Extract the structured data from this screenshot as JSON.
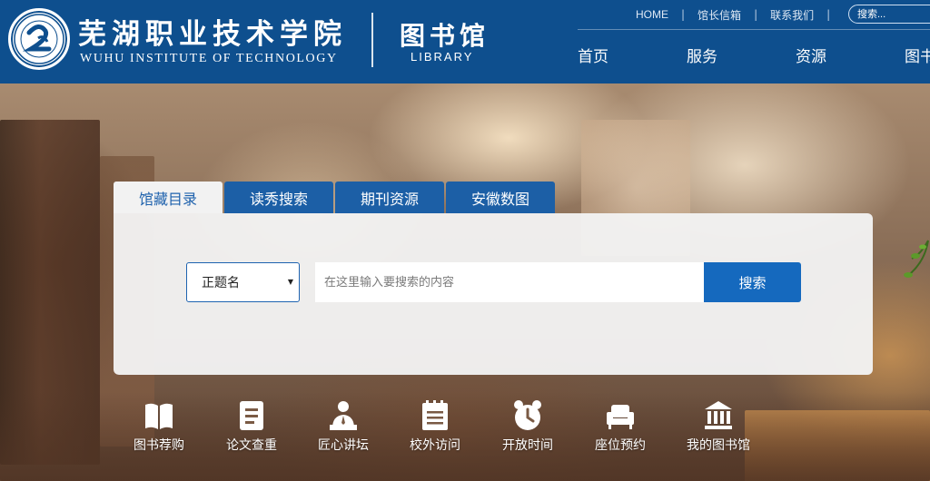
{
  "header": {
    "school_name_cn": "芜湖职业技术学院",
    "school_name_en": "WUHU INSTITUTE OF TECHNOLOGY",
    "library_cn": "图书馆",
    "library_en": "LIBRARY",
    "top_links": [
      "HOME",
      "馆长信箱",
      "联系我们"
    ],
    "search_placeholder": "搜索...",
    "nav": [
      "首页",
      "服务",
      "资源",
      "图书"
    ]
  },
  "search": {
    "tabs": [
      "馆藏目录",
      "读秀搜索",
      "期刊资源",
      "安徽数图"
    ],
    "active_tab": 0,
    "field_select": "正题名",
    "input_placeholder": "在这里输入要搜索的内容",
    "button_label": "搜索"
  },
  "quick_links": [
    {
      "label": "图书荐购",
      "icon": "book-open-icon"
    },
    {
      "label": "论文查重",
      "icon": "document-icon"
    },
    {
      "label": "匠心讲坛",
      "icon": "lecturer-icon"
    },
    {
      "label": "校外访问",
      "icon": "notepad-icon"
    },
    {
      "label": "开放时间",
      "icon": "alarm-clock-icon"
    },
    {
      "label": "座位预约",
      "icon": "armchair-icon"
    },
    {
      "label": "我的图书馆",
      "icon": "library-building-icon"
    }
  ],
  "colors": {
    "header_bg": "#0e4f8e",
    "tab_bg": "#1c5fa6",
    "button_bg": "#1569be"
  }
}
